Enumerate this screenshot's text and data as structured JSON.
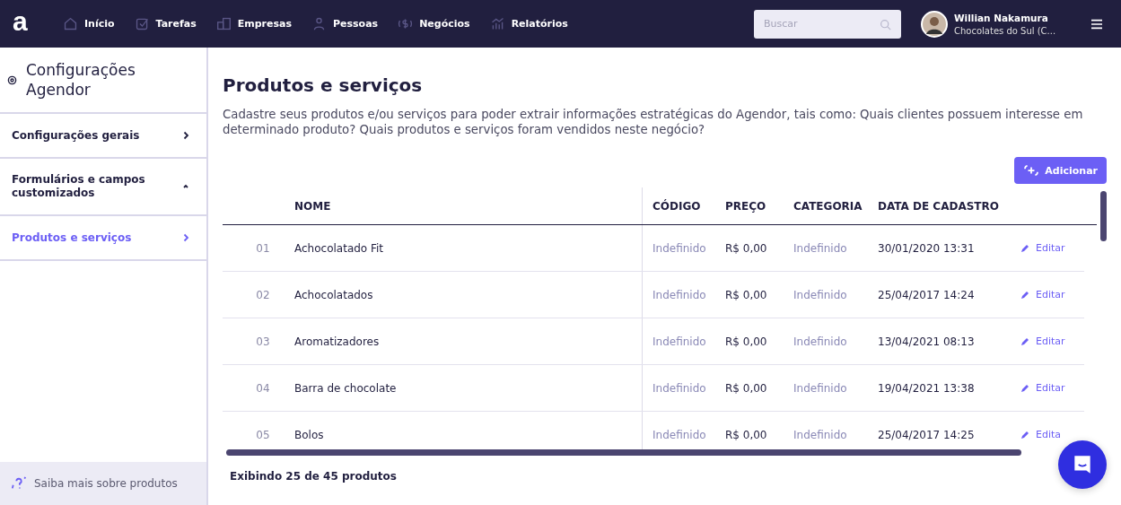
{
  "topbar": {
    "logo": "a",
    "nav": [
      {
        "label": "Início"
      },
      {
        "label": "Tarefas"
      },
      {
        "label": "Empresas"
      },
      {
        "label": "Pessoas"
      },
      {
        "label": "Negócios"
      },
      {
        "label": "Relatórios"
      }
    ],
    "search": {
      "placeholder": "Buscar"
    },
    "user": {
      "name": "Willian Nakamura",
      "company": "Chocolates do Sul (C..."
    }
  },
  "sidebar": {
    "title": "Configurações Agendor",
    "items": [
      {
        "label": "Configurações gerais",
        "selected": false,
        "expanded": false
      },
      {
        "label": "Formulários e campos customizados",
        "selected": false,
        "expanded": true
      },
      {
        "label": "Produtos e serviços",
        "selected": true,
        "expanded": false
      }
    ],
    "help_link": "Saiba mais sobre produtos"
  },
  "page": {
    "title": "Produtos e serviços",
    "description": "Cadastre seus produtos e/ou serviços para poder extrair informações estratégicas do Agendor, tais como: Quais clientes possuem interesse em determinado produto? Quais produtos e serviços foram vendidos neste negócio?",
    "add_button": "Adicionar"
  },
  "table": {
    "columns": [
      "NOME",
      "CÓDIGO",
      "PREÇO",
      "CATEGORIA",
      "DATA DE CADASTRO"
    ],
    "rows": [
      {
        "index": "01",
        "name": "Achocolatado Fit",
        "code": "Indefinido",
        "price": "R$ 0,00",
        "category": "Indefinido",
        "date": "30/01/2020 13:31",
        "action": "Editar"
      },
      {
        "index": "02",
        "name": "Achocolatados",
        "code": "Indefinido",
        "price": "R$ 0,00",
        "category": "Indefinido",
        "date": "25/04/2017 14:24",
        "action": "Editar"
      },
      {
        "index": "03",
        "name": "Aromatizadores",
        "code": "Indefinido",
        "price": "R$ 0,00",
        "category": "Indefinido",
        "date": "13/04/2021 08:13",
        "action": "Editar"
      },
      {
        "index": "04",
        "name": "Barra de chocolate",
        "code": "Indefinido",
        "price": "R$ 0,00",
        "category": "Indefinido",
        "date": "19/04/2021 13:38",
        "action": "Editar"
      },
      {
        "index": "05",
        "name": "Bolos",
        "code": "Indefinido",
        "price": "R$ 0,00",
        "category": "Indefinido",
        "date": "25/04/2017 14:25",
        "action": "Edita"
      }
    ]
  },
  "footer": "Exibindo 25 de 45 produtos"
}
